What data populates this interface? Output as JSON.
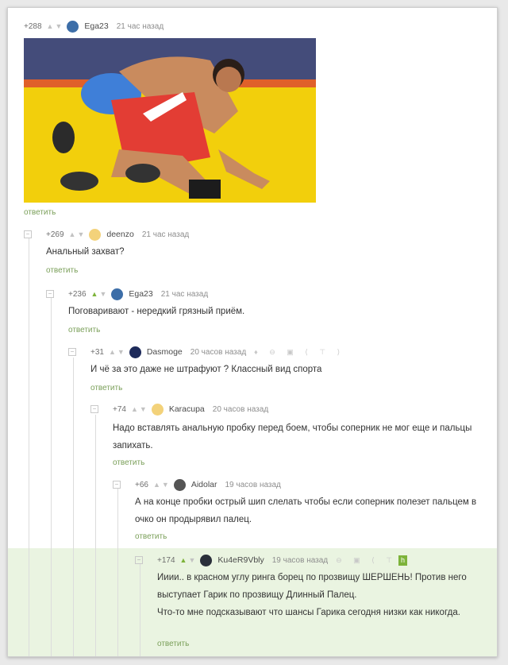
{
  "comments": [
    {
      "score": "+288",
      "user": "Ega23",
      "time": "21 час назад",
      "text": "",
      "reply": "ответить"
    },
    {
      "score": "+269",
      "user": "deenzo",
      "time": "21 час назад",
      "text": "Анальный захват?",
      "reply": "ответить"
    },
    {
      "score": "+236",
      "user": "Ega23",
      "time": "21 час назад",
      "text": "Поговаривают - нередкий грязный приём.",
      "reply": "ответить"
    },
    {
      "score": "+31",
      "user": "Dasmoge",
      "time": "20 часов назад",
      "text": "И чё за это даже не штрафуют ? Классный вид спорта",
      "reply": "ответить"
    },
    {
      "score": "+74",
      "user": "Karacupa",
      "time": "20 часов назад",
      "text": "Надо вставлять анальную пробку перед боем, чтобы соперник не мог еще и пальцы запихать.",
      "reply": "ответить"
    },
    {
      "score": "+66",
      "user": "Aidolar",
      "time": "19 часов назад",
      "text": "А на конце пробки острый шип слелать чтобы если соперник полезет пальцем в очко он продырявил палец.",
      "reply": "ответить"
    },
    {
      "score": "+174",
      "user": "Ku4eR9Vbly",
      "time": "19 часов назад",
      "text": "Ииии.. в красном углу ринга борец по прозвищу ШЕРШЕНЬ! Против него выступает Гарик по прозвищу Длинный Палец.",
      "text2": "Что-то мне подсказывают что шансы Гарика сегодня низки как никогда.",
      "reply": "ответить"
    }
  ],
  "icons": {
    "up": "arrow-up-icon",
    "down": "arrow-down-icon",
    "collapse": "collapse-minus-icon",
    "h_button": "h"
  },
  "colors": {
    "green": "#7db33a",
    "reply": "#7a9f59",
    "highlight": "#eaf4e1"
  }
}
